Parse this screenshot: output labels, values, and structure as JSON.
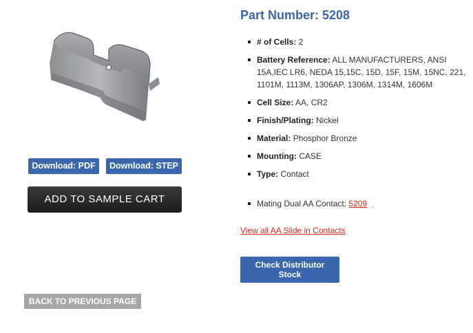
{
  "product": {
    "title": "Part Number: 5208",
    "image_alt": "battery contact part image"
  },
  "downloads": {
    "pdf_label": "Download: PDF",
    "step_label": "Download: STEP"
  },
  "cart": {
    "add_label": "ADD TO SAMPLE CART"
  },
  "navigation": {
    "back_label": "BACK TO PREVIOUS PAGE"
  },
  "specs": [
    {
      "label": "# of Cells:",
      "value": "2"
    },
    {
      "label": "Battery Reference:",
      "value": "ALL MANUFACTURERS, ANSI 15A,IEC LR6, NEDA 15,15C, 15D, 15F, 15M, 15NC, 221, 1101M, 1113M, 1306AP, 1306M, 1314M, 1606M"
    },
    {
      "label": "Cell Size:",
      "value": "AA, CR2"
    },
    {
      "label": "Finish/Plating:",
      "value": "Nickel"
    },
    {
      "label": "Material:",
      "value": "Phosphor Bronze"
    },
    {
      "label": "Mounting:",
      "value": "CASE"
    },
    {
      "label": "Type:",
      "value": "Contact"
    }
  ],
  "mating": {
    "label": "Mating Dual AA Contact:",
    "link": "5209"
  },
  "view_all_link": "View all AA Slide in Contacts",
  "distributor": {
    "label": "Check Distributor Stock"
  },
  "colors": {
    "accent_blue": "#3a66ad",
    "title_blue": "#3c66a8",
    "link_red": "#d9281e",
    "cart_dark": "#222222",
    "back_gray": "#a7a7a7"
  }
}
